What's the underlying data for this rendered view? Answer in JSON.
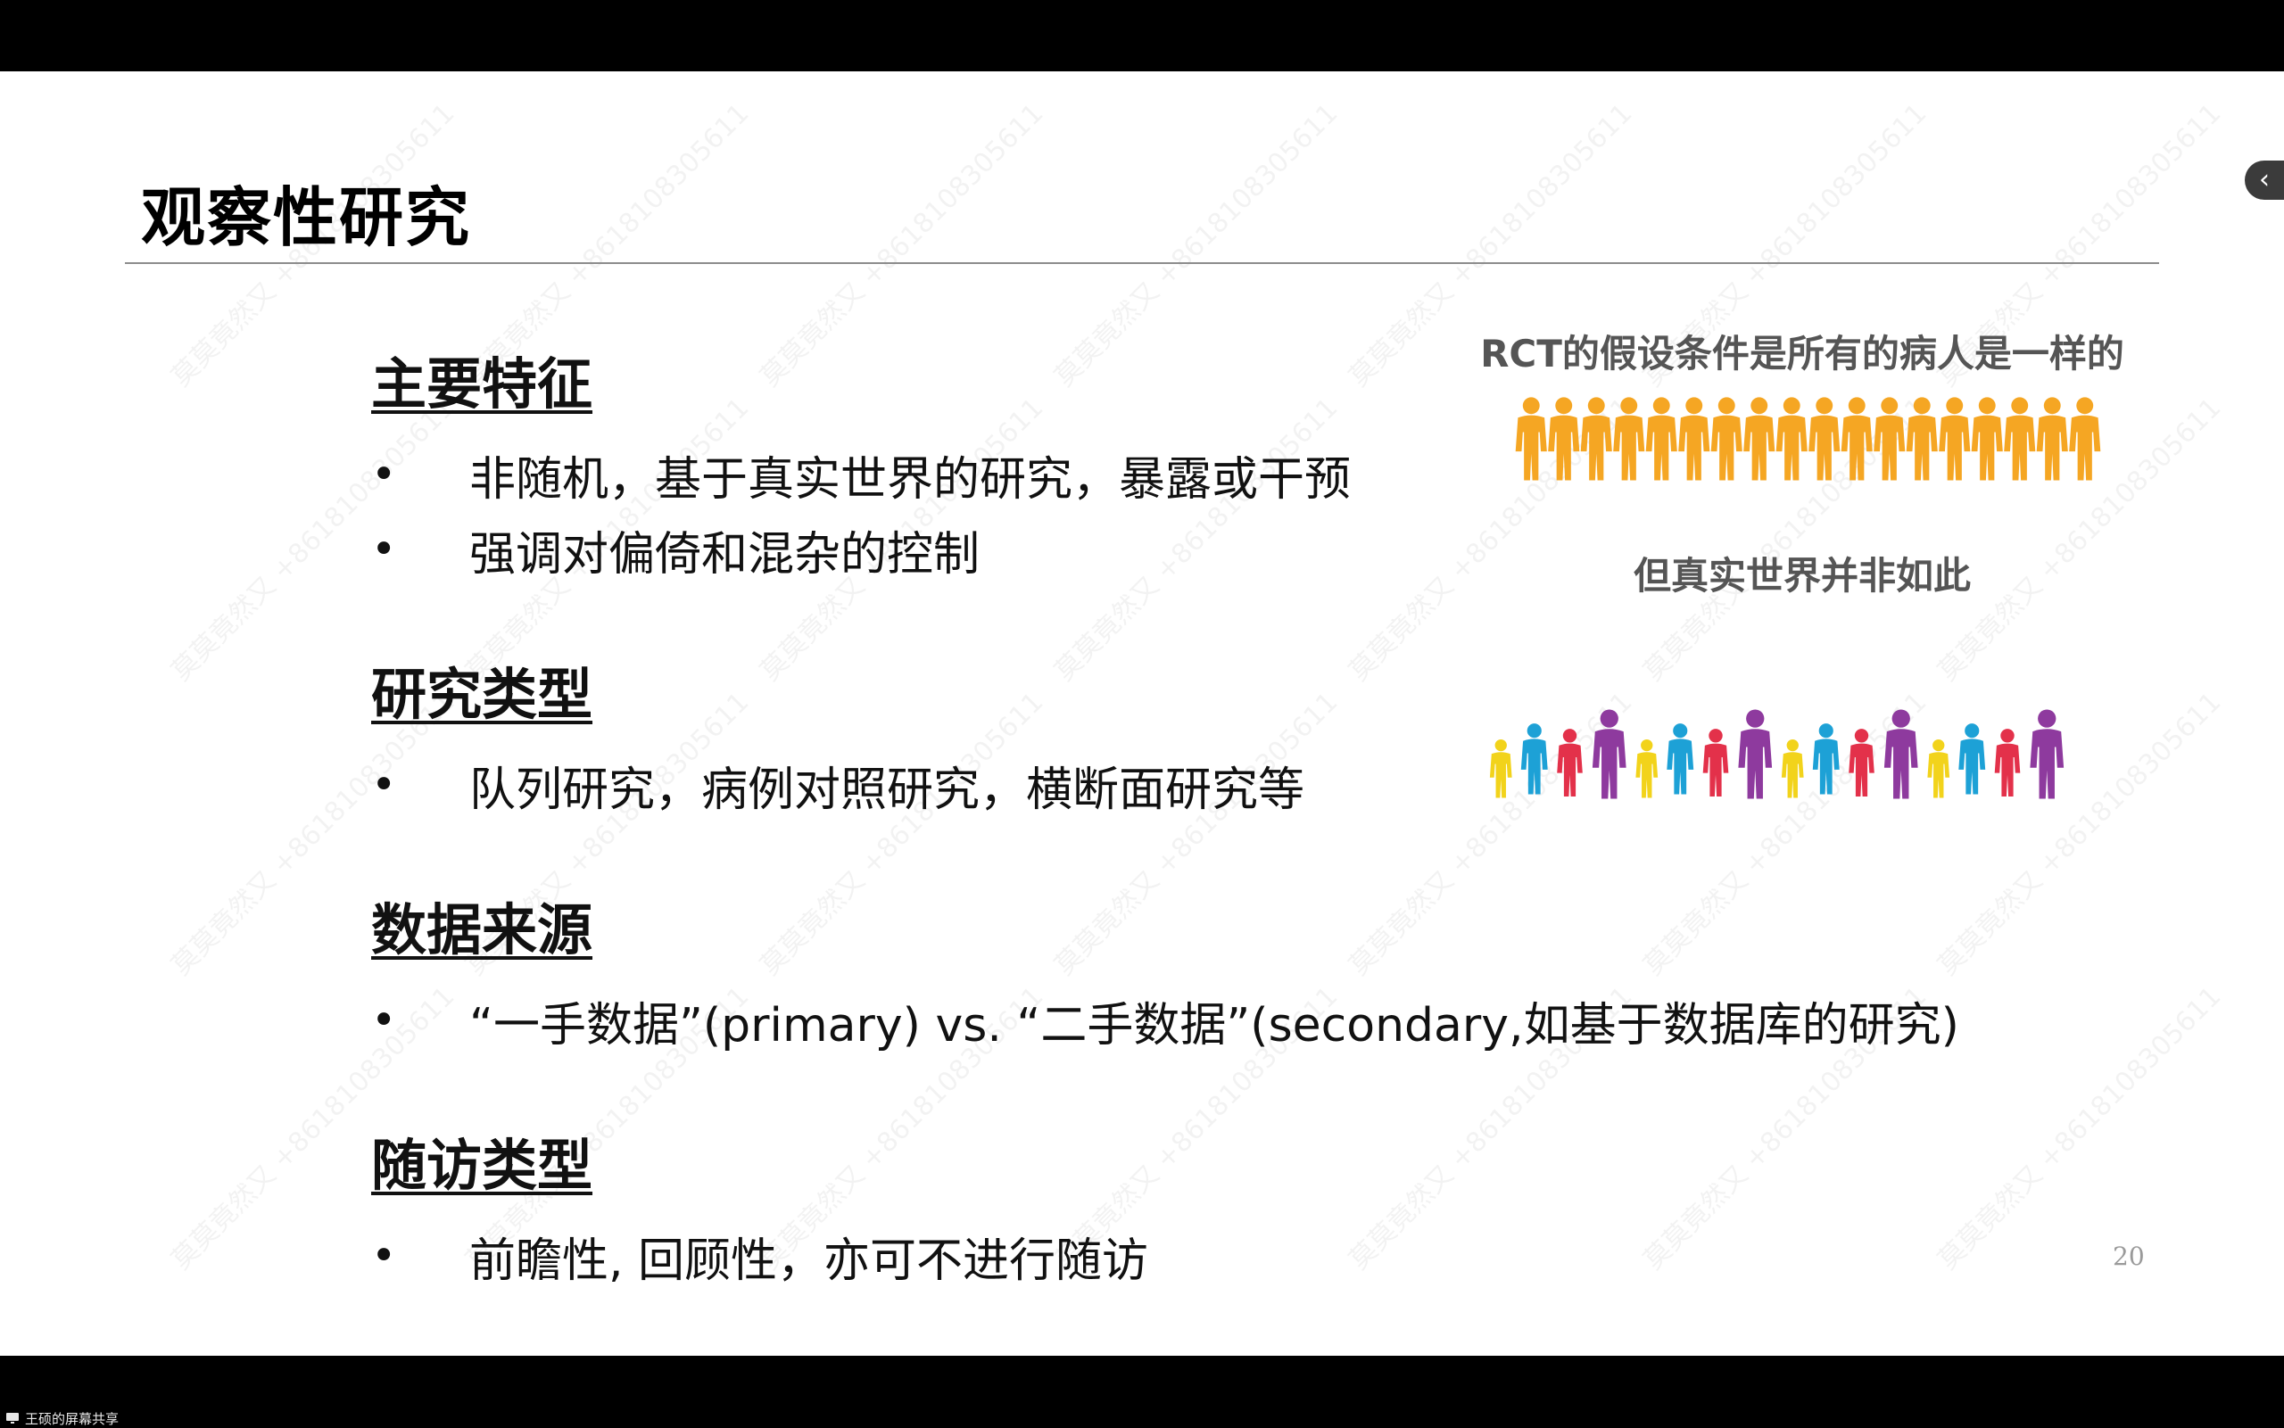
{
  "slide": {
    "title": "观察性研究",
    "sections": [
      {
        "heading": "主要特征",
        "bullets": [
          "非随机，基于真实世界的研究，暴露或干预",
          "强调对偏倚和混杂的控制"
        ]
      },
      {
        "heading": "研究类型",
        "bullets": [
          "队列研究，病例对照研究，横断面研究等"
        ]
      },
      {
        "heading": "数据来源",
        "bullets": [
          "“一手数据”(primary) vs. “二手数据”(secondary,如基于数据库的研究)"
        ]
      },
      {
        "heading": "随访类型",
        "bullets": [
          "前瞻性, 回顾性，亦可不进行随访"
        ]
      }
    ],
    "bullet_symbol": "•",
    "illustration": {
      "caption_top": "RCT的假设条件是所有的病人是一样的",
      "caption_bottom": "但真实世界并非如此",
      "uniform_color": "#F5A623",
      "diverse_colors": [
        "#F2D31B",
        "#1DA1D6",
        "#E3314A",
        "#8E3A9E"
      ]
    },
    "page_number": "20",
    "watermark": "莫莫竟然又 +8618108305611"
  },
  "side_tab": {
    "icon": "chevron-left-icon",
    "glyph": "‹"
  },
  "taskbar": {
    "label": "王硕的屏幕共享"
  }
}
